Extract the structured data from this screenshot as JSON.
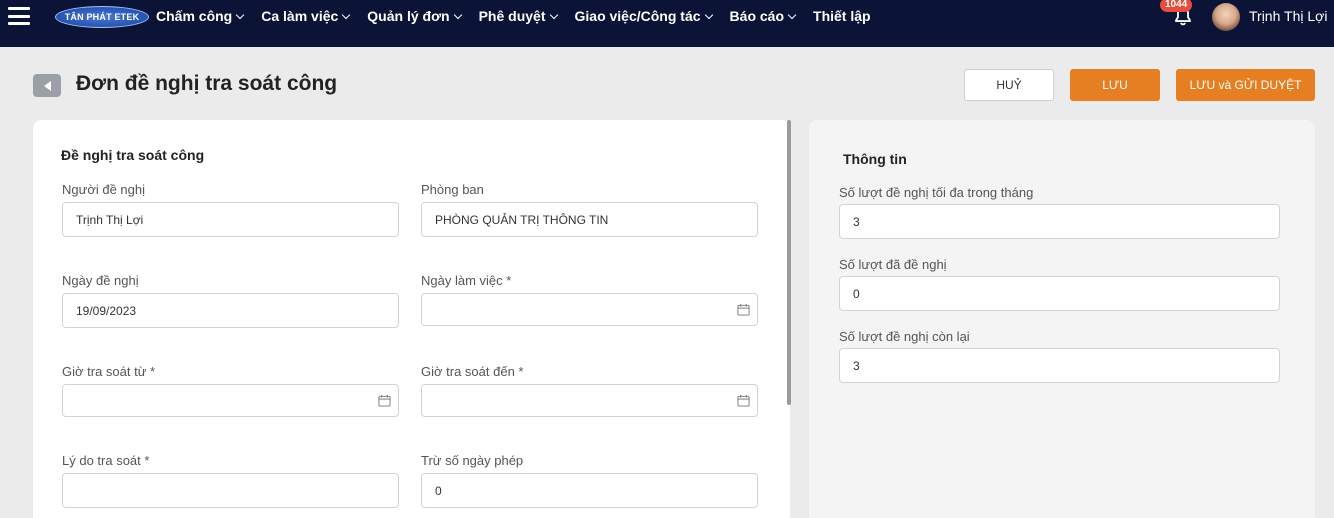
{
  "nav": {
    "logo_text": "TÂN PHÁT ETEK",
    "items": [
      {
        "label": "Chấm công"
      },
      {
        "label": "Ca làm việc"
      },
      {
        "label": "Quản lý đơn"
      },
      {
        "label": "Phê duyệt"
      },
      {
        "label": "Giao việc/Công tác"
      },
      {
        "label": "Báo cáo"
      },
      {
        "label": "Thiết lập"
      }
    ],
    "notification_count": "1044",
    "user_name": "Trịnh Thị Lợi"
  },
  "header": {
    "title": "Đơn đề nghị tra soát công",
    "cancel_label": "HUỶ",
    "save_label": "LƯU",
    "save_send_label": "LƯU và GỬI DUYỆT"
  },
  "form": {
    "section_title": "Đề nghị tra soát công",
    "requester": {
      "label": "Người đề nghị",
      "value": "Trịnh Thị Lợi"
    },
    "department": {
      "label": "Phòng ban",
      "value": "PHÒNG QUẢN TRỊ THÔNG TIN"
    },
    "request_date": {
      "label": "Ngày đề nghị",
      "value": "19/09/2023"
    },
    "work_date": {
      "label": "Ngày làm việc *",
      "value": ""
    },
    "time_from": {
      "label": "Giờ tra soát từ *",
      "value": ""
    },
    "time_to": {
      "label": "Giờ tra soát đến *",
      "value": ""
    },
    "reason": {
      "label": "Lý do tra soát *",
      "value": ""
    },
    "leave_deduct": {
      "label": "Trừ số ngày phép",
      "value": "0"
    }
  },
  "info": {
    "section_title": "Thông tin",
    "max_requests": {
      "label": "Số lượt đề nghị tối đa trong tháng",
      "value": "3"
    },
    "used_requests": {
      "label": "Số lượt đã đề nghị",
      "value": "0"
    },
    "remaining_requests": {
      "label": "Số lượt đề nghị còn lại",
      "value": "3"
    }
  },
  "colors": {
    "nav_bg": "#0b1437",
    "accent": "#e67e22",
    "badge": "#e74c3c"
  }
}
